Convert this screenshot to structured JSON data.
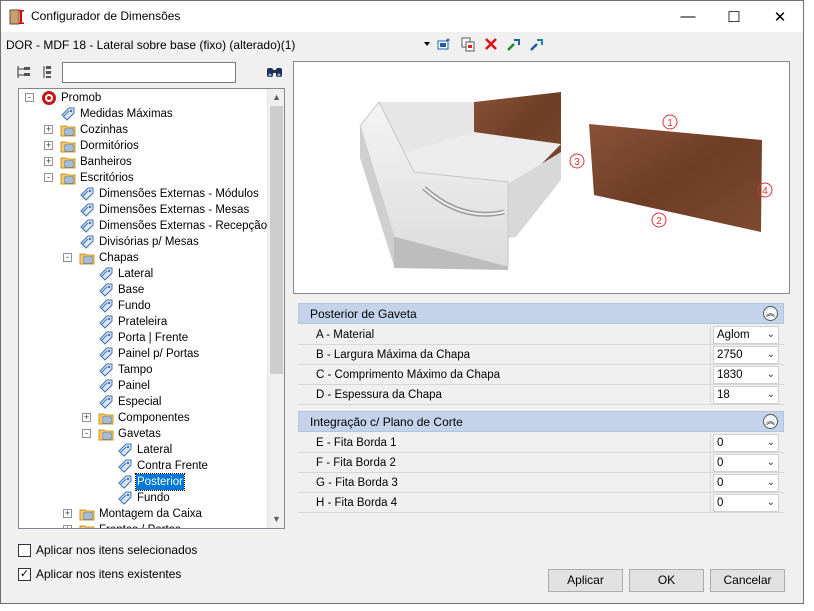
{
  "window": {
    "title": "Configurador de Dimensões",
    "minimize": "—",
    "maximize": "☐",
    "close": "✕"
  },
  "toolbar": {
    "preset": "DOR - MDF 18 - Lateral sobre base (fixo) (alterado)(1)"
  },
  "search": {
    "value": "",
    "placeholder": ""
  },
  "tree": [
    {
      "label": "Promob",
      "level": 0,
      "exp": "-",
      "icon": "root"
    },
    {
      "label": "Medidas Máximas",
      "level": 1,
      "exp": "",
      "icon": "tag"
    },
    {
      "label": "Cozinhas",
      "level": 1,
      "exp": "+",
      "icon": "folder"
    },
    {
      "label": "Dormitórios",
      "level": 1,
      "exp": "+",
      "icon": "folder"
    },
    {
      "label": "Banheiros",
      "level": 1,
      "exp": "+",
      "icon": "folder"
    },
    {
      "label": "Escritórios",
      "level": 1,
      "exp": "-",
      "icon": "folder"
    },
    {
      "label": "Dimensões Externas - Módulos",
      "level": 2,
      "exp": "",
      "icon": "tag"
    },
    {
      "label": "Dimensões Externas - Mesas",
      "level": 2,
      "exp": "",
      "icon": "tag"
    },
    {
      "label": "Dimensões Externas - Recepção",
      "level": 2,
      "exp": "",
      "icon": "tag"
    },
    {
      "label": "Divisórias p/ Mesas",
      "level": 2,
      "exp": "",
      "icon": "tag"
    },
    {
      "label": "Chapas",
      "level": 2,
      "exp": "-",
      "icon": "folder"
    },
    {
      "label": "Lateral",
      "level": 3,
      "exp": "",
      "icon": "tag"
    },
    {
      "label": "Base",
      "level": 3,
      "exp": "",
      "icon": "tag"
    },
    {
      "label": "Fundo",
      "level": 3,
      "exp": "",
      "icon": "tag"
    },
    {
      "label": "Prateleira",
      "level": 3,
      "exp": "",
      "icon": "tag"
    },
    {
      "label": "Porta | Frente",
      "level": 3,
      "exp": "",
      "icon": "tag"
    },
    {
      "label": "Painel p/ Portas",
      "level": 3,
      "exp": "",
      "icon": "tag"
    },
    {
      "label": "Tampo",
      "level": 3,
      "exp": "",
      "icon": "tag"
    },
    {
      "label": "Painel",
      "level": 3,
      "exp": "",
      "icon": "tag"
    },
    {
      "label": "Especial",
      "level": 3,
      "exp": "",
      "icon": "tag"
    },
    {
      "label": "Componentes",
      "level": 3,
      "exp": "+",
      "icon": "folder"
    },
    {
      "label": "Gavetas",
      "level": 3,
      "exp": "-",
      "icon": "folder"
    },
    {
      "label": "Lateral",
      "level": 4,
      "exp": "",
      "icon": "tag"
    },
    {
      "label": "Contra Frente",
      "level": 4,
      "exp": "",
      "icon": "tag"
    },
    {
      "label": "Posterior",
      "level": 4,
      "exp": "",
      "icon": "tag",
      "selected": true
    },
    {
      "label": "Fundo",
      "level": 4,
      "exp": "",
      "icon": "tag"
    },
    {
      "label": "Montagem da Caixa",
      "level": 2,
      "exp": "+",
      "icon": "folder"
    },
    {
      "label": "Frentes / Portas",
      "level": 2,
      "exp": "+",
      "icon": "folder"
    }
  ],
  "preview": {
    "markers": [
      "1",
      "2",
      "3",
      "4"
    ]
  },
  "section1": {
    "title": "Posterior de Gaveta"
  },
  "props1": [
    {
      "label": "A - Material",
      "value": "Aglom"
    },
    {
      "label": "B - Largura Máxima da Chapa",
      "value": "2750"
    },
    {
      "label": "C - Comprimento Máximo da Chapa",
      "value": "1830"
    },
    {
      "label": "D - Espessura da Chapa",
      "value": "18"
    }
  ],
  "section2": {
    "title": "Integração c/ Plano de Corte"
  },
  "props2": [
    {
      "label": "E - Fita Borda 1",
      "value": "0"
    },
    {
      "label": "F - Fita Borda 2",
      "value": "0"
    },
    {
      "label": "G - Fita Borda 3",
      "value": "0"
    },
    {
      "label": "H - Fita Borda 4",
      "value": "0"
    }
  ],
  "options": {
    "selected_label": "Aplicar nos itens selecionados",
    "selected_checked": false,
    "existing_label": "Aplicar nos itens existentes",
    "existing_checked": true
  },
  "buttons": {
    "apply": "Aplicar",
    "ok": "OK",
    "cancel": "Cancelar"
  }
}
